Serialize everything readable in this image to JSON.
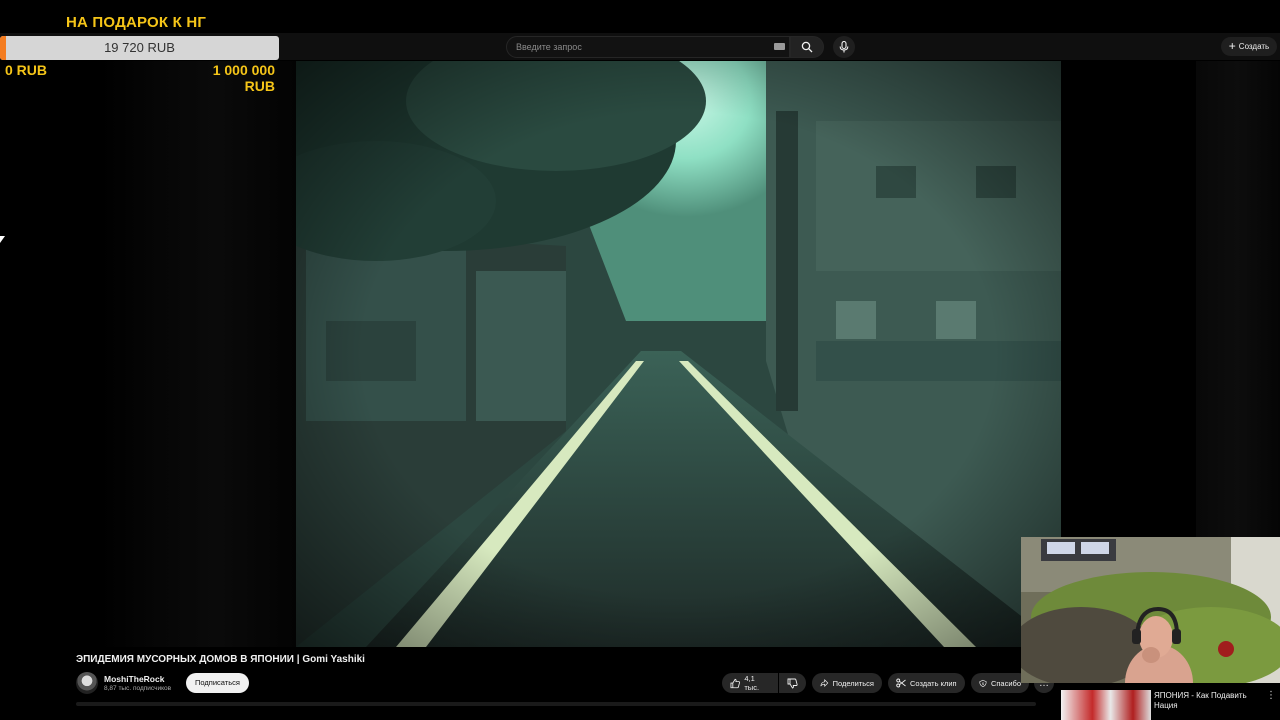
{
  "goal": {
    "title": "НА ПОДАРОК К НГ",
    "current": "19 720 RUB",
    "min": "0 RUB",
    "max": "1 000 000 RUB",
    "progress": 0.01972
  },
  "header": {
    "search_placeholder": "Введите запрос",
    "create_label": "Создать"
  },
  "video": {
    "title": "ЭПИДЕМИЯ МУСОРНЫХ ДОМОВ В ЯПОНИИ | Gomi Yashiki"
  },
  "channel": {
    "name": "MoshiTheRock",
    "subscribers": "8,87 тыс. подписчиков",
    "subscribe_label": "Подписаться"
  },
  "actions": {
    "likes": "4,1 тыс.",
    "share": "Поделиться",
    "clip": "Создать клип",
    "thanks": "Спасибо",
    "more": "…"
  },
  "recommended": {
    "title": "ЯПОНИЯ - Как Подавить Нация",
    "more": "⋮"
  },
  "colors": {
    "goal_text": "#f5c518",
    "goal_fill": "#f47c20",
    "bg": "#0f0f0f"
  }
}
